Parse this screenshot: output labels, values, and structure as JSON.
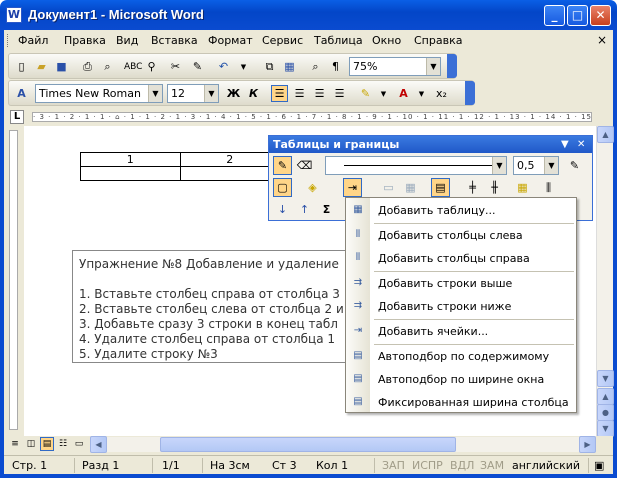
{
  "window": {
    "title": "Документ1 - Microsoft Word",
    "app_icon": "W",
    "buttons": {
      "minimize": "_",
      "maximize": "□",
      "close": "✕"
    }
  },
  "menu": {
    "items": [
      "Файл",
      "Правка",
      "Вид",
      "Вставка",
      "Формат",
      "Сервис",
      "Таблица",
      "Окно",
      "Справка"
    ],
    "close_doc": "×"
  },
  "toolbar_standard": {
    "zoom": "75%",
    "undo_glyph": "↶",
    "redo_glyph": "↷",
    "show_marks": "¶"
  },
  "toolbar_format": {
    "style_glyph": "A",
    "font": "Times New Roman",
    "size": "12",
    "bold": "Ж",
    "italic": "К",
    "subscript": "x₂"
  },
  "ruler": {
    "tab_selector": "L",
    "scale": "· 3 · 1 · 2 · 1 · 1 · ⌂ · 1 · 1 · 2 · 1 · 3 · 1 · 4 · 1 · 5 · 1 · 6 · 1 · 7 · 1 · 8 · 1 · 9 · 1 · 10 · 1 · 11 · 1 · 12 · 1 · 13 · 1 · 14 · 1 · 15 · 1 · 16 · 1 · 17 ·"
  },
  "document": {
    "table": {
      "row1": [
        "1",
        "2"
      ],
      "row2": [
        "",
        ""
      ]
    },
    "exercise_lines": [
      "Упражнение №8 Добавление и удаление",
      "",
      "1. Вставьте столбец справа от столбца 3",
      "2. Вставьте столбец слева от столбца 2 и",
      "3. Добавьте сразу 3 строки в конец табл",
      "4. Удалите столбец справа от столбца 1",
      "5. Удалите строку №3"
    ]
  },
  "tables_toolbar": {
    "title": "Таблицы и границы",
    "line_weight": "0,5",
    "sum_glyph": "Σ"
  },
  "insert_menu": {
    "items": [
      {
        "label": "Добавить таблицу...",
        "icon": "table-icon"
      },
      {
        "label": "Добавить столбцы слева",
        "icon": "insert-columns-left-icon"
      },
      {
        "label": "Добавить столбцы справа",
        "icon": "insert-columns-right-icon"
      },
      {
        "label": "Добавить строки выше",
        "icon": "insert-rows-above-icon"
      },
      {
        "label": "Добавить строки ниже",
        "icon": "insert-rows-below-icon"
      },
      {
        "label": "Добавить ячейки...",
        "icon": "insert-cells-icon"
      },
      {
        "label": "Автоподбор по содержимому",
        "icon": "autofit-contents-icon"
      },
      {
        "label": "Автоподбор по ширине окна",
        "icon": "autofit-window-icon"
      },
      {
        "label": "Фиксированная ширина столбца",
        "icon": "fixed-width-icon"
      }
    ]
  },
  "status": {
    "page": "Стр. 1",
    "section": "Разд 1",
    "pages": "1/1",
    "at": "На 3см",
    "line": "Ст 3",
    "col": "Кол 1",
    "rec": "ЗАП",
    "trk": "ИСПР",
    "ext": "ВДЛ",
    "ovr": "ЗАМ",
    "lang": "английский"
  }
}
